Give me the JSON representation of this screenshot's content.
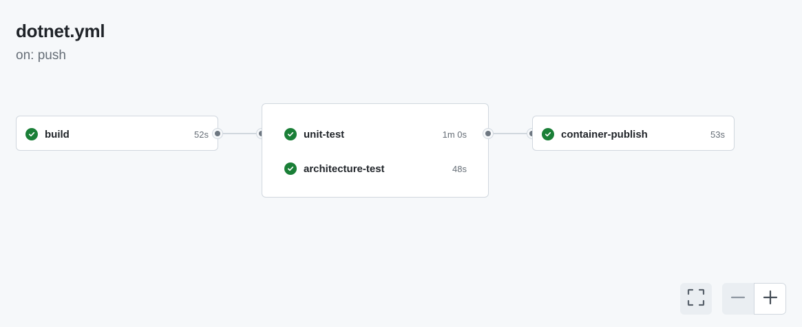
{
  "workflow": {
    "title": "dotnet.yml",
    "trigger": "on: push"
  },
  "jobs": {
    "build": {
      "name": "build",
      "duration": "52s",
      "status": "success"
    },
    "unit_test": {
      "name": "unit-test",
      "duration": "1m 0s",
      "status": "success"
    },
    "architecture_test": {
      "name": "architecture-test",
      "duration": "48s",
      "status": "success"
    },
    "container_publish": {
      "name": "container-publish",
      "duration": "53s",
      "status": "success"
    }
  },
  "icons": {
    "status": "check-circle-icon",
    "fullscreen": "fullscreen-icon",
    "zoom_out": "minus-icon",
    "zoom_in": "plus-icon"
  },
  "colors": {
    "success": "#1a7f37",
    "background": "#f6f8fa",
    "border": "#d0d7de"
  }
}
